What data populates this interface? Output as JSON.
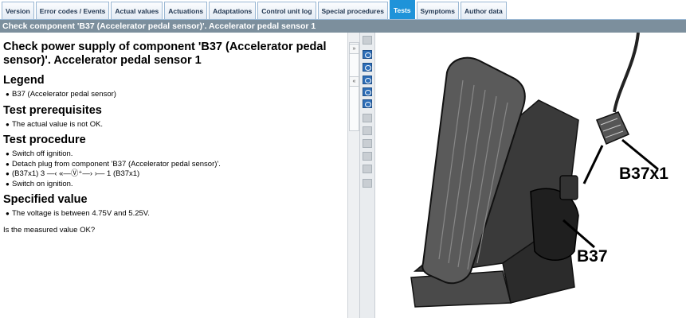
{
  "tabs": [
    {
      "label": "Version",
      "active": false
    },
    {
      "label": "Error codes / Events",
      "active": false
    },
    {
      "label": "Actual values",
      "active": false
    },
    {
      "label": "Actuations",
      "active": false
    },
    {
      "label": "Adaptations",
      "active": false
    },
    {
      "label": "Control unit log",
      "active": false
    },
    {
      "label": "Special procedures",
      "active": false
    },
    {
      "label": "Tests",
      "active": true
    },
    {
      "label": "Symptoms",
      "active": false
    },
    {
      "label": "Author data",
      "active": false
    }
  ],
  "title_bar": "Check component 'B37 (Accelerator pedal sensor)'. Accelerator pedal sensor 1",
  "content": {
    "heading": "Check power supply of component 'B37 (Accelerator pedal sensor)'. Accelerator pedal sensor 1",
    "legend": {
      "title": "Legend",
      "items": [
        "B37 (Accelerator pedal sensor)"
      ]
    },
    "prerequisites": {
      "title": "Test prerequisites",
      "items": [
        "The actual value is not OK."
      ]
    },
    "procedure": {
      "title": "Test procedure",
      "items": [
        "Switch off ignition.",
        "Detach plug from component 'B37 (Accelerator pedal sensor)'.",
        "(B37x1) 3 —‹ «—Ⓥ⁺—› ›— 1 (B37x1)",
        "Switch on ignition."
      ]
    },
    "specified": {
      "title": "Specified value",
      "items": [
        "The voltage is between 4.75V and 5.25V."
      ]
    },
    "question": "Is the measured value OK?"
  },
  "scrollbar": {
    "collapse_up": "»",
    "collapse_down": "«"
  },
  "toolbar": {
    "icons": [
      "page-icon",
      "zoom-in-icon",
      "zoom-out-icon",
      "zoom-fit-icon",
      "fit-width-icon",
      "fit-page-icon",
      "tool-7-icon",
      "tool-8-icon",
      "tool-9-icon",
      "tool-10-icon",
      "tool-11-icon",
      "tool-12-icon"
    ]
  },
  "diagram": {
    "labels": {
      "connector": "B37x1",
      "component": "B37"
    }
  }
}
